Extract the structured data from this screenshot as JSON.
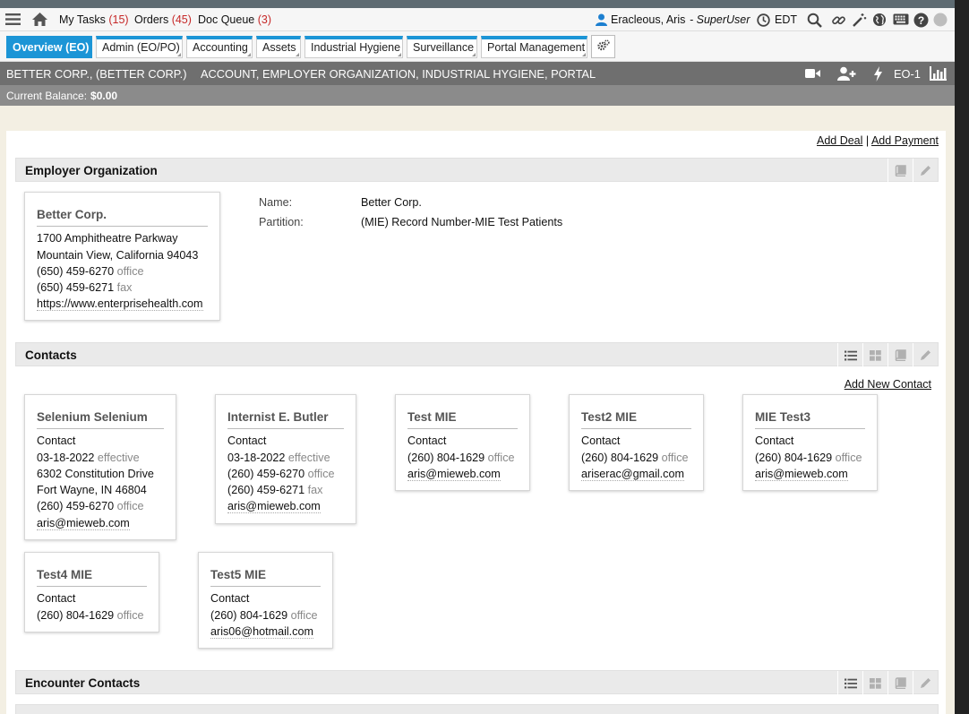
{
  "topbar": {
    "my_tasks_label": "My Tasks",
    "my_tasks_count": "(15)",
    "orders_label": "Orders",
    "orders_count": "(45)",
    "doc_queue_label": "Doc Queue",
    "doc_queue_count": "(3)",
    "user_name": "Eracleous, Aris",
    "user_role": "- SuperUser",
    "timezone": "EDT"
  },
  "tabs": [
    {
      "label": "Overview (EO)"
    },
    {
      "label": "Admin (EO/PO)"
    },
    {
      "label": "Accounting"
    },
    {
      "label": "Assets"
    },
    {
      "label": "Industrial Hygiene"
    },
    {
      "label": "Surveillance"
    },
    {
      "label": "Portal Management"
    }
  ],
  "account": {
    "name": "BETTER CORP., (BETTER CORP.)",
    "types": "ACCOUNT, EMPLOYER ORGANIZATION, INDUSTRIAL HYGIENE, PORTAL",
    "code": "EO-1",
    "balance_label": "Current Balance:",
    "balance_value": "$0.00"
  },
  "actions": {
    "add_deal": "Add Deal",
    "separator": "|",
    "add_payment": "Add Payment"
  },
  "employer": {
    "section_title": "Employer Organization",
    "card_title": "Better Corp.",
    "address1": "1700 Amphitheatre Parkway",
    "address2": "Mountain View, California 94043",
    "phone1": "(650) 459-6270",
    "phone1_label": "office",
    "phone2": "(650) 459-6271",
    "phone2_label": "fax",
    "website": "https://www.enterprisehealth.com",
    "name_label": "Name:",
    "name_value": "Better Corp.",
    "partition_label": "Partition:",
    "partition_value": "(MIE) Record Number-MIE Test Patients"
  },
  "contacts": {
    "section_title": "Contacts",
    "add_new": "Add New Contact",
    "items": [
      {
        "title": "Selenium Selenium",
        "l1": "Contact",
        "date": "03-18-2022",
        "date_label": "effective",
        "addr1": "6302 Constitution Drive",
        "addr2": "Fort Wayne, IN 46804",
        "phone": "(260) 459-6270",
        "phone_label": "office",
        "email": "aris@mieweb.com"
      },
      {
        "title": "Internist E. Butler",
        "l1": "Contact",
        "date": "03-18-2022",
        "date_label": "effective",
        "phone": "(260) 459-6270",
        "phone_label": "office",
        "phone2": "(260) 459-6271",
        "phone2_label": "fax",
        "email": "aris@mieweb.com"
      },
      {
        "title": "Test MIE",
        "l1": "Contact",
        "phone": "(260) 804-1629",
        "phone_label": "office",
        "email": "aris@mieweb.com"
      },
      {
        "title": "Test2 MIE",
        "l1": "Contact",
        "phone": "(260) 804-1629",
        "phone_label": "office",
        "email": "ariserac@gmail.com"
      },
      {
        "title": "MIE Test3",
        "l1": "Contact",
        "phone": "(260) 804-1629",
        "phone_label": "office",
        "email": "aris@mieweb.com"
      },
      {
        "title": "Test4 MIE",
        "l1": "Contact",
        "phone": "(260) 804-1629",
        "phone_label": "office"
      },
      {
        "title": "Test5 MIE",
        "l1": "Contact",
        "phone": "(260) 804-1629",
        "phone_label": "office",
        "email": "aris06@hotmail.com"
      }
    ]
  },
  "encounter_contacts": {
    "section_title": "Encounter Contacts"
  },
  "colors": {
    "accent": "#1c95d6",
    "count_red": "#c62828",
    "account_bar": "#6f6f6f"
  },
  "icons": [
    "hamburger-menu-icon",
    "home-icon",
    "user-icon",
    "clock-icon",
    "search-icon",
    "link-icon",
    "magic-wand-icon",
    "globe-icon",
    "keyboard-icon",
    "help-icon",
    "status-dot-icon",
    "gear-icon",
    "video-icon",
    "add-user-icon",
    "lightning-icon",
    "bar-chart-icon",
    "list-view-icon",
    "grid-view-icon",
    "book-icon",
    "pencil-icon"
  ]
}
